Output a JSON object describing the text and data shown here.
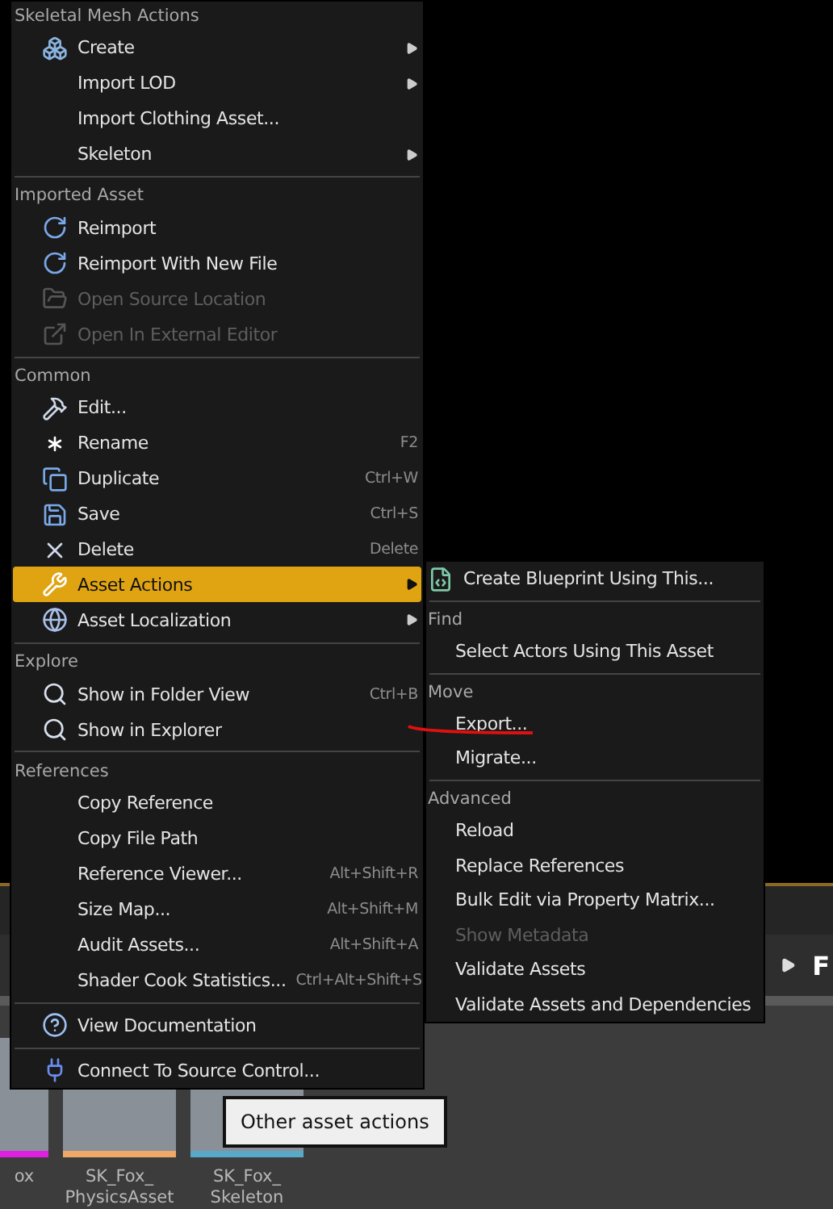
{
  "main_menu": {
    "sections": [
      {
        "header": "Skeletal Mesh Actions",
        "items": [
          {
            "label": "Create",
            "kind": "icon",
            "submenu": true,
            "disabled": false,
            "selected": false
          },
          {
            "label": "Import LOD",
            "kind": "plain",
            "submenu": true,
            "disabled": false,
            "selected": false
          },
          {
            "label": "Import Clothing Asset...",
            "kind": "plain",
            "submenu": false,
            "disabled": false,
            "selected": false
          },
          {
            "label": "Skeleton",
            "kind": "plain",
            "submenu": true,
            "disabled": false,
            "selected": false
          }
        ]
      },
      {
        "header": "Imported Asset",
        "items": [
          {
            "label": "Reimport",
            "kind": "icon",
            "submenu": false,
            "disabled": false,
            "selected": false
          },
          {
            "label": "Reimport With New File",
            "kind": "icon",
            "submenu": false,
            "disabled": false,
            "selected": false
          },
          {
            "label": "Open Source Location",
            "kind": "icon",
            "submenu": false,
            "disabled": true,
            "selected": false
          },
          {
            "label": "Open In External Editor",
            "kind": "icon",
            "submenu": false,
            "disabled": true,
            "selected": false
          }
        ]
      },
      {
        "header": "Common",
        "items": [
          {
            "label": "Edit...",
            "kind": "icon",
            "submenu": false,
            "disabled": false,
            "selected": false
          },
          {
            "label": "Rename",
            "kind": "icon",
            "shortcut": "F2",
            "submenu": false,
            "disabled": false,
            "selected": false
          },
          {
            "label": "Duplicate",
            "kind": "icon",
            "shortcut": "Ctrl+W",
            "submenu": false,
            "disabled": false,
            "selected": false
          },
          {
            "label": "Save",
            "kind": "icon",
            "shortcut": "Ctrl+S",
            "submenu": false,
            "disabled": false,
            "selected": false
          },
          {
            "label": "Delete",
            "kind": "icon",
            "shortcut": "Delete",
            "submenu": false,
            "disabled": false,
            "selected": false
          },
          {
            "label": "Asset Actions",
            "kind": "icon",
            "submenu": true,
            "disabled": false,
            "selected": true
          },
          {
            "label": "Asset Localization",
            "kind": "icon",
            "submenu": true,
            "disabled": false,
            "selected": false
          }
        ]
      },
      {
        "header": "Explore",
        "items": [
          {
            "label": "Show in Folder View",
            "kind": "icon",
            "shortcut": "Ctrl+B",
            "submenu": false,
            "disabled": false,
            "selected": false
          },
          {
            "label": "Show in Explorer",
            "kind": "icon",
            "submenu": false,
            "disabled": false,
            "selected": false
          }
        ]
      },
      {
        "header": "References",
        "items": [
          {
            "label": "Copy Reference",
            "kind": "plain",
            "submenu": false,
            "disabled": false,
            "selected": false
          },
          {
            "label": "Copy File Path",
            "kind": "plain",
            "submenu": false,
            "disabled": false,
            "selected": false
          },
          {
            "label": "Reference Viewer...",
            "kind": "plain",
            "shortcut": "Alt+Shift+R",
            "submenu": false,
            "disabled": false,
            "selected": false
          },
          {
            "label": "Size Map...",
            "kind": "plain",
            "shortcut": "Alt+Shift+M",
            "submenu": false,
            "disabled": false,
            "selected": false
          },
          {
            "label": "Audit Assets...",
            "kind": "plain",
            "shortcut": "Alt+Shift+A",
            "submenu": false,
            "disabled": false,
            "selected": false
          },
          {
            "label": "Shader Cook Statistics...",
            "kind": "plain",
            "shortcut": "Ctrl+Alt+Shift+S",
            "submenu": false,
            "disabled": false,
            "selected": false
          }
        ]
      },
      {
        "items": [
          {
            "label": "View Documentation",
            "kind": "icon",
            "submenu": false,
            "disabled": false,
            "selected": false
          }
        ]
      },
      {
        "items": [
          {
            "label": "Connect To Source Control...",
            "kind": "icon",
            "submenu": false,
            "disabled": false,
            "selected": false
          }
        ]
      }
    ]
  },
  "submenu": {
    "sections": [
      {
        "items": [
          {
            "label": "Create Blueprint Using This...",
            "kind": "icon",
            "disabled": false
          }
        ]
      },
      {
        "header": "Find",
        "items": [
          {
            "label": "Select Actors Using This Asset",
            "kind": "plain",
            "disabled": false
          }
        ]
      },
      {
        "header": "Move",
        "items": [
          {
            "label": "Export...",
            "kind": "plain",
            "disabled": false
          },
          {
            "label": "Migrate...",
            "kind": "plain",
            "disabled": false
          }
        ]
      },
      {
        "header": "Advanced",
        "items": [
          {
            "label": "Reload",
            "kind": "plain",
            "disabled": false
          },
          {
            "label": "Replace References",
            "kind": "plain",
            "disabled": false
          },
          {
            "label": "Bulk Edit via Property Matrix...",
            "kind": "plain",
            "disabled": false
          },
          {
            "label": "Show Metadata",
            "kind": "plain",
            "disabled": true
          },
          {
            "label": "Validate Assets",
            "kind": "plain",
            "disabled": false
          },
          {
            "label": "Validate Assets and Dependencies",
            "kind": "plain",
            "disabled": false
          }
        ]
      }
    ]
  },
  "toolbar": {
    "label": "F"
  },
  "assets": [
    {
      "label_lines": [
        "ox"
      ],
      "color": "#e020e0"
    },
    {
      "label_lines": [
        "SK_Fox_",
        "PhysicsAsset"
      ],
      "color": "#f0a868"
    },
    {
      "label_lines": [
        "SK_Fox_",
        "Skeleton"
      ],
      "color": "#58a8c8"
    }
  ],
  "tooltip": {
    "text": "Other asset actions"
  }
}
